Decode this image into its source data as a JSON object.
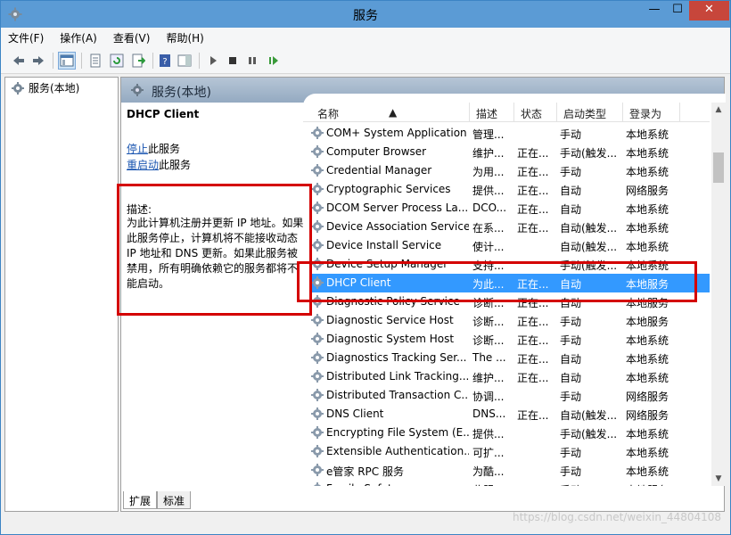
{
  "window": {
    "title": "服务"
  },
  "menu": [
    "文件(F)",
    "操作(A)",
    "查看(V)",
    "帮助(H)"
  ],
  "tree": {
    "root_label": "服务(本地)"
  },
  "pane": {
    "header_title": "服务(本地)"
  },
  "detail": {
    "service_name": "DHCP Client",
    "stop_link": "停止",
    "stop_suffix": "此服务",
    "restart_link": "重启动",
    "restart_suffix": "此服务",
    "desc_label": "描述:",
    "desc_lines": [
      "为此计算机注册并更新 IP 地址。如果",
      "此服务停止，计算机将不能接收动态",
      "IP 地址和 DNS 更新。如果此服务被",
      "禁用，所有明确依赖它的服务都将不",
      "能启动。"
    ]
  },
  "columns": {
    "name": "名称",
    "desc": "描述",
    "status": "状态",
    "start_type": "启动类型",
    "logon": "登录为"
  },
  "services": [
    {
      "name": "COM+ System Application",
      "desc": "管理...",
      "status": "",
      "start": "手动",
      "logon": "本地系统"
    },
    {
      "name": "Computer Browser",
      "desc": "维护...",
      "status": "正在...",
      "start": "手动(触发...",
      "logon": "本地系统"
    },
    {
      "name": "Credential Manager",
      "desc": "为用...",
      "status": "正在...",
      "start": "手动",
      "logon": "本地系统"
    },
    {
      "name": "Cryptographic Services",
      "desc": "提供...",
      "status": "正在...",
      "start": "自动",
      "logon": "网络服务"
    },
    {
      "name": "DCOM Server Process La...",
      "desc": "DCO...",
      "status": "正在...",
      "start": "自动",
      "logon": "本地系统"
    },
    {
      "name": "Device Association Service",
      "desc": "在系...",
      "status": "正在...",
      "start": "自动(触发...",
      "logon": "本地系统"
    },
    {
      "name": "Device Install Service",
      "desc": "使计...",
      "status": "",
      "start": "自动(触发...",
      "logon": "本地系统"
    },
    {
      "name": "Device Setup Manager",
      "desc": "支持...",
      "status": "",
      "start": "手动(触发...",
      "logon": "本地系统"
    },
    {
      "name": "DHCP Client",
      "desc": "为此...",
      "status": "正在...",
      "start": "自动",
      "logon": "本地服务"
    },
    {
      "name": "Diagnostic Policy Service",
      "desc": "诊断...",
      "status": "正在...",
      "start": "自动",
      "logon": "本地服务"
    },
    {
      "name": "Diagnostic Service Host",
      "desc": "诊断...",
      "status": "正在...",
      "start": "手动",
      "logon": "本地服务"
    },
    {
      "name": "Diagnostic System Host",
      "desc": "诊断...",
      "status": "正在...",
      "start": "手动",
      "logon": "本地系统"
    },
    {
      "name": "Diagnostics Tracking Ser...",
      "desc": "The ...",
      "status": "正在...",
      "start": "自动",
      "logon": "本地系统"
    },
    {
      "name": "Distributed Link Tracking...",
      "desc": "维护...",
      "status": "正在...",
      "start": "自动",
      "logon": "本地系统"
    },
    {
      "name": "Distributed Transaction C...",
      "desc": "协调...",
      "status": "",
      "start": "手动",
      "logon": "网络服务"
    },
    {
      "name": "DNS Client",
      "desc": "DNS...",
      "status": "正在...",
      "start": "自动(触发...",
      "logon": "网络服务"
    },
    {
      "name": "Encrypting File System (E...",
      "desc": "提供...",
      "status": "",
      "start": "手动(触发...",
      "logon": "本地系统"
    },
    {
      "name": "Extensible Authentication...",
      "desc": "可扩...",
      "status": "",
      "start": "手动",
      "logon": "本地系统"
    },
    {
      "name": "e管家 RPC 服务",
      "desc": "为酷...",
      "status": "",
      "start": "手动",
      "logon": "本地系统"
    },
    {
      "name": "Family Safety",
      "desc": "此服...",
      "status": "",
      "start": "手动",
      "logon": "本地服务"
    }
  ],
  "selected_service": "DHCP Client",
  "tabs": [
    "扩展",
    "标准"
  ],
  "watermark": "https://blog.csdn.net/weixin_44804108",
  "colors": {
    "selection": "#3399ff",
    "highlight_box": "#d40000",
    "title_bar": "#5b9bd5"
  }
}
